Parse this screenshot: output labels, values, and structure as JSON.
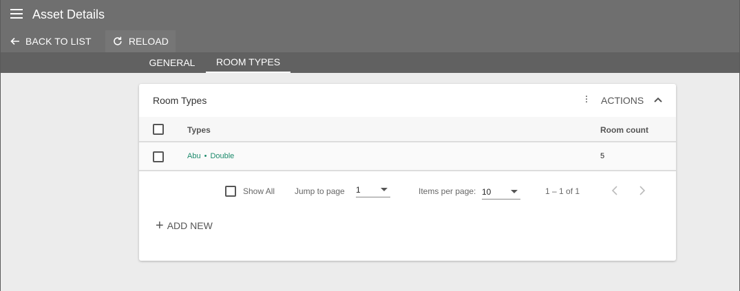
{
  "header": {
    "title": "Asset Details",
    "back_label": "BACK TO LIST",
    "reload_label": "RELOAD"
  },
  "tabs": [
    {
      "label": "GENERAL",
      "active": false
    },
    {
      "label": "ROOM TYPES",
      "active": true
    }
  ],
  "card": {
    "title": "Room Types",
    "actions_label": "ACTIONS"
  },
  "table": {
    "columns": [
      "Types",
      "Room count"
    ],
    "rows": [
      {
        "type_name": "Abu",
        "separator": "•",
        "type_kind": "Double",
        "room_count": "5"
      }
    ]
  },
  "pager": {
    "show_all_label": "Show All",
    "jump_label": "Jump to page",
    "jump_value": "1",
    "items_per_page_label": "Items per page:",
    "items_per_page_value": "10",
    "range_label": "1 – 1 of 1"
  },
  "add_new_label": "ADD NEW",
  "colors": {
    "appbar": "#6f6f6f",
    "tabbar": "#616161",
    "link": "#1b8a6b",
    "background": "#ececec"
  },
  "icons": [
    "menu-icon",
    "arrow-left-icon",
    "refresh-icon",
    "more-vert-icon",
    "chevron-up-icon",
    "chevron-left-icon",
    "chevron-right-icon",
    "plus-icon"
  ]
}
